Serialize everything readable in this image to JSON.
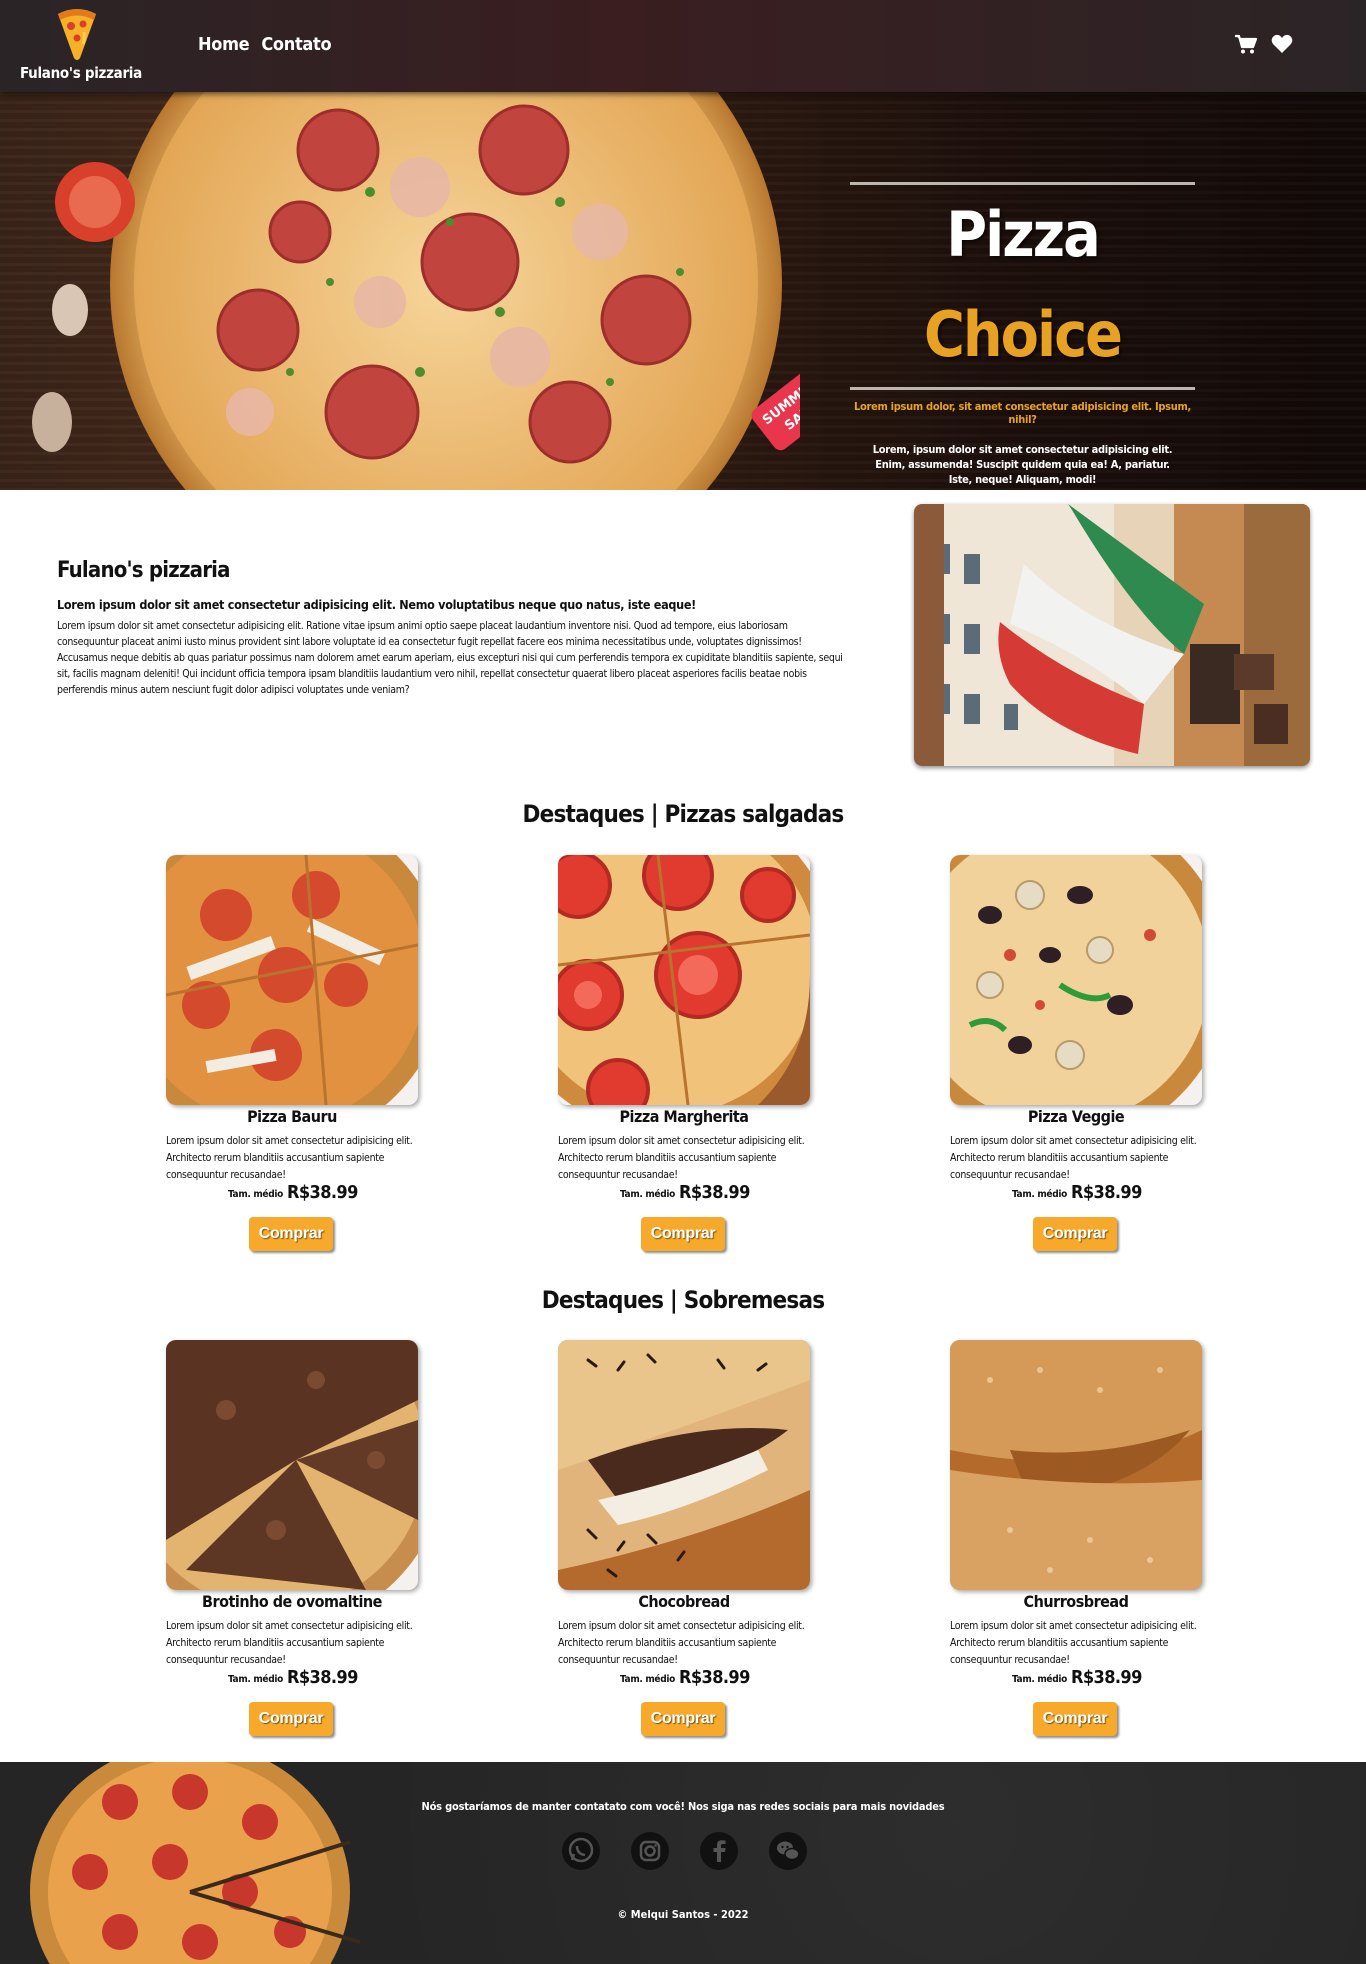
{
  "nav": {
    "brand": "Fulano's pizzaria",
    "links": [
      "Home",
      "Contato"
    ],
    "icons": [
      "cart-icon",
      "heart-icon"
    ]
  },
  "hero": {
    "title_part1": "Pizza",
    "title_part2": "Choice",
    "subtitle": "Lorem ipsum dolor, sit amet consectetur adipisicing elit. Ipsum, nihil?",
    "description": "Lorem, ipsum dolor sit amet consectetur adipisicing elit. Enim, assumenda! Suscipit quidem quia ea! A, pariatur. Iste, neque! Aliquam, modi!",
    "sale_tag": [
      "SUMMER",
      "SALE"
    ]
  },
  "about": {
    "title": "Fulano's pizzaria",
    "lead": "Lorem ipsum dolor sit amet consectetur adipisicing elit. Nemo voluptatibus neque quo natus, iste eaque!",
    "body": "Lorem ipsum dolor sit amet consectetur adipisicing elit. Ratione vitae ipsum animi optio saepe placeat laudantium inventore nisi. Quod ad tempore, eius laboriosam consequuntur placeat animi iusto minus provident sint labore voluptate id ea consectetur fugit repellat facere eos minima necessitatibus unde, voluptates dignissimos! Accusamus neque debitis ab quas pariatur possimus nam dolorem amet earum aperiam, eius excepturi nisi qui cum perferendis tempora ex cupiditate blanditiis sapiente, sequi sit, facilis magnam deleniti! Qui incidunt officia tempora ipsam blanditiis laudantium vero nihil, repellat consectetur quaerat libero placeat asperiores facilis beatae nobis perferendis minus autem nesciunt fugit dolor adipisci voluptates unde veniam?"
  },
  "pizzas": {
    "title": "Destaques | Pizzas salgadas",
    "items": [
      {
        "name": "Pizza Bauru",
        "desc": "Lorem ipsum dolor sit amet consectetur adipisicing elit. Architecto rerum blanditiis accusantium sapiente consequuntur recusandae!",
        "size": "Tam. médio",
        "price": "R$38.99",
        "buy": "Comprar"
      },
      {
        "name": "Pizza Margherita",
        "desc": "Lorem ipsum dolor sit amet consectetur adipisicing elit. Architecto rerum blanditiis accusantium sapiente consequuntur recusandae!",
        "size": "Tam. médio",
        "price": "R$38.99",
        "buy": "Comprar"
      },
      {
        "name": "Pizza Veggie",
        "desc": "Lorem ipsum dolor sit amet consectetur adipisicing elit. Architecto rerum blanditiis accusantium sapiente consequuntur recusandae!",
        "size": "Tam. médio",
        "price": "R$38.99",
        "buy": "Comprar"
      }
    ]
  },
  "desserts": {
    "title": "Destaques | Sobremesas",
    "items": [
      {
        "name": "Brotinho de ovomaltine",
        "desc": "Lorem ipsum dolor sit amet consectetur adipisicing elit. Architecto rerum blanditiis accusantium sapiente consequuntur recusandae!",
        "size": "Tam. médio",
        "price": "R$38.99",
        "buy": "Comprar"
      },
      {
        "name": "Chocobread",
        "desc": "Lorem ipsum dolor sit amet consectetur adipisicing elit. Architecto rerum blanditiis accusantium sapiente consequuntur recusandae!",
        "size": "Tam. médio",
        "price": "R$38.99",
        "buy": "Comprar"
      },
      {
        "name": "Churrosbread",
        "desc": "Lorem ipsum dolor sit amet consectetur adipisicing elit. Architecto rerum blanditiis accusantium sapiente consequuntur recusandae!",
        "size": "Tam. médio",
        "price": "R$38.99",
        "buy": "Comprar"
      }
    ]
  },
  "footer": {
    "message": "Nós gostaríamos de manter contatato com você! Nos siga nas redes sociais para mais novidades",
    "socials": [
      "whatsapp-icon",
      "instagram-icon",
      "facebook-icon",
      "wechat-icon"
    ],
    "copyright": "© Melqui Santos - 2022"
  },
  "colors": {
    "accent": "#e8a223",
    "button": "#f6a92a",
    "navbar": "#2a2426",
    "footer": "#252525"
  }
}
